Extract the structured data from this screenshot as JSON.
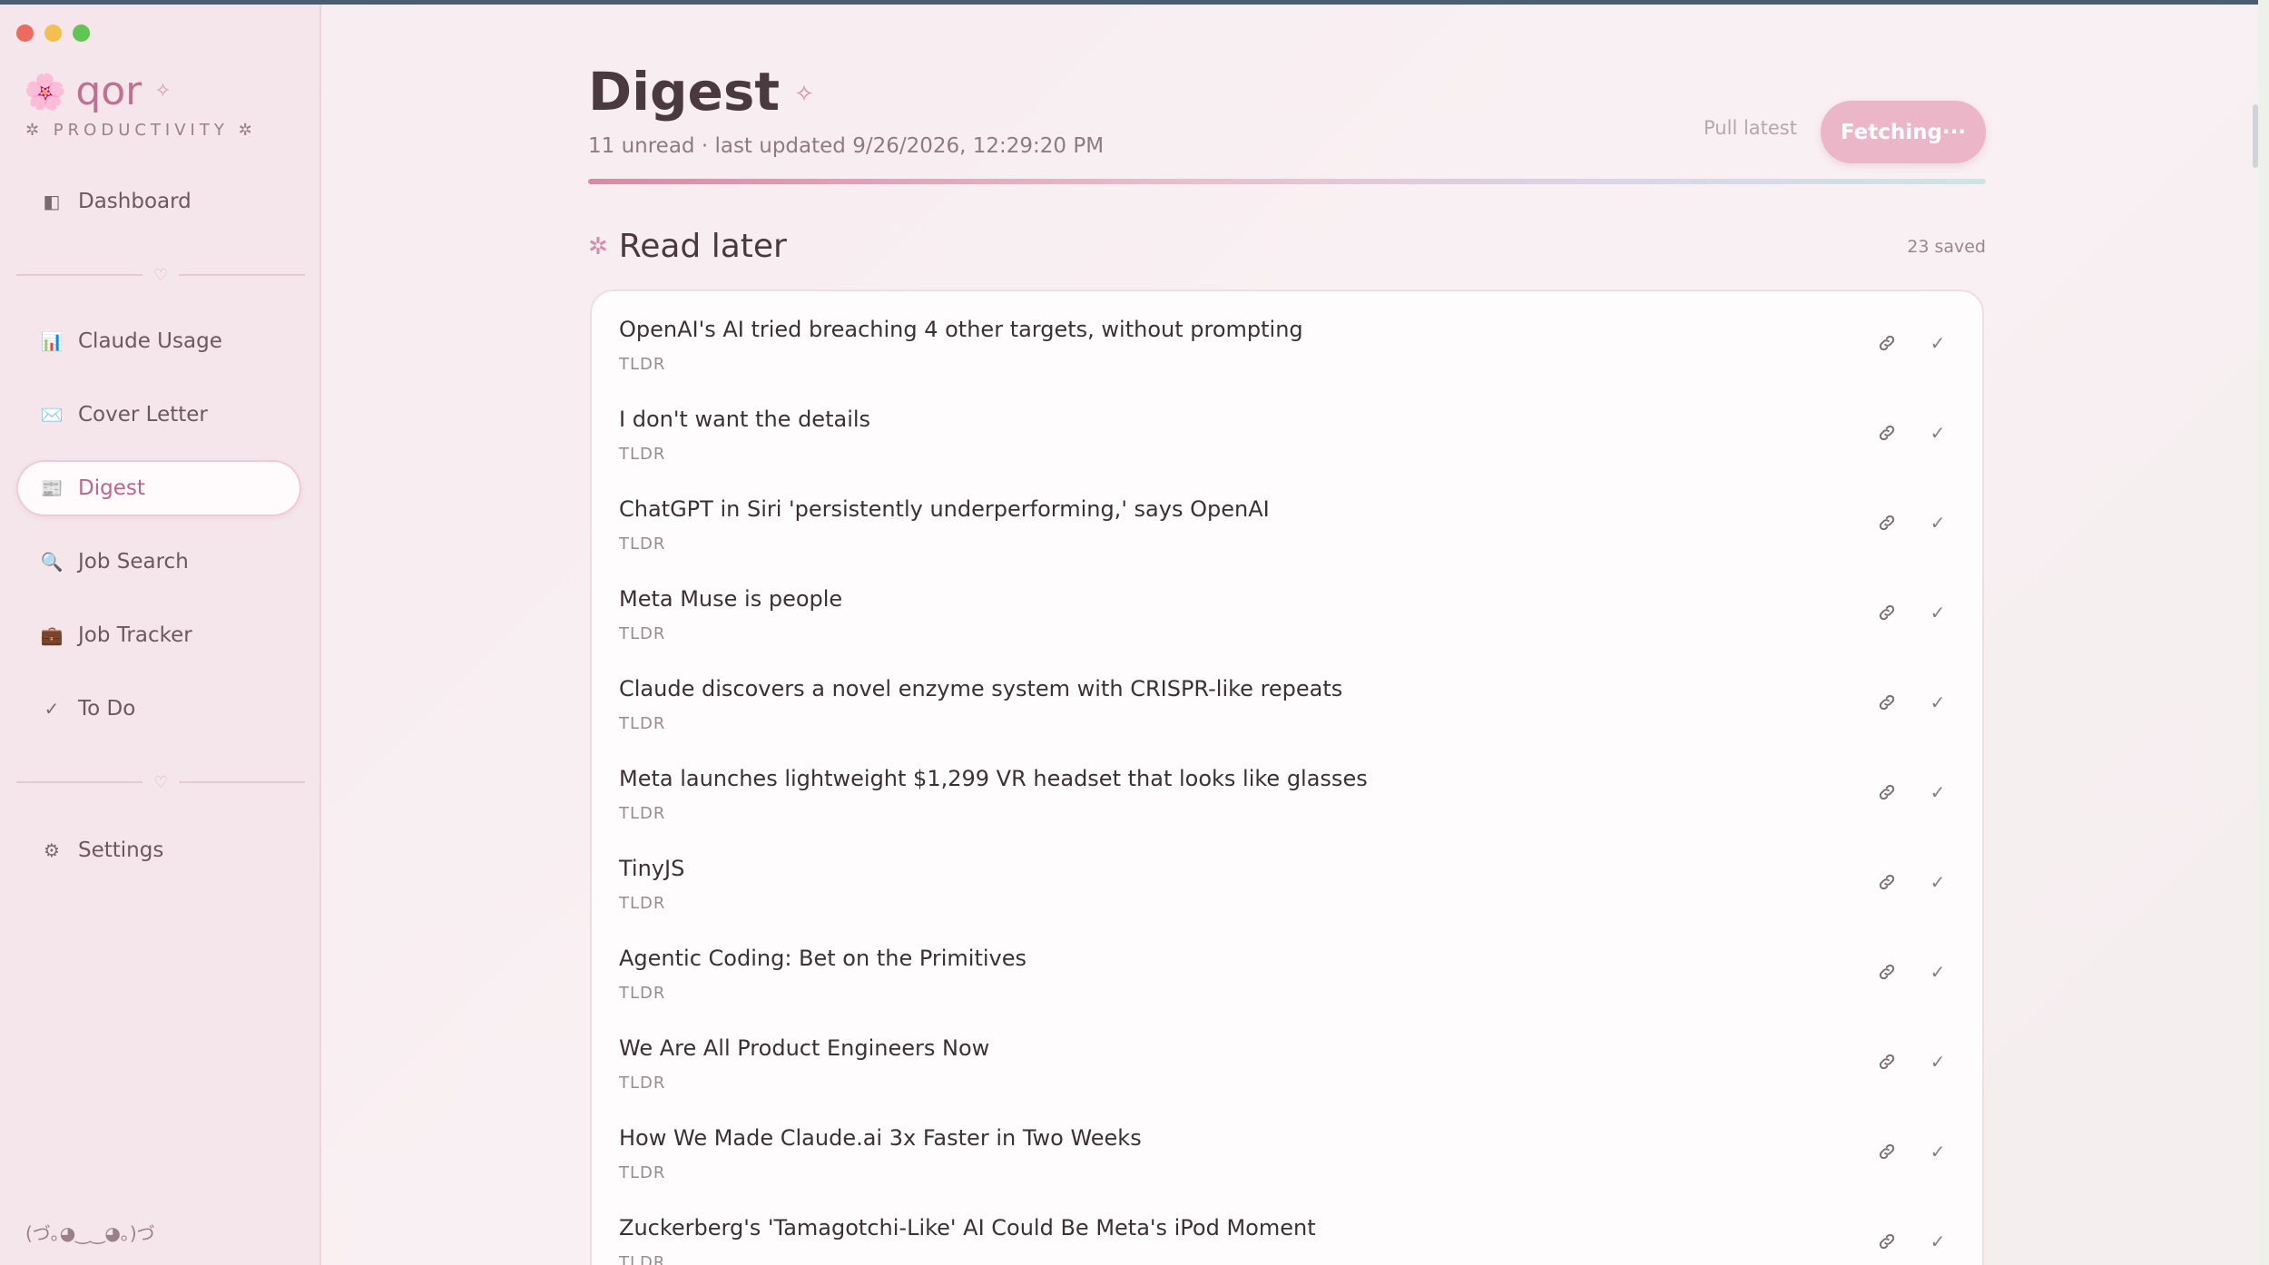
{
  "sidebar": {
    "brand": {
      "flower_icon": "cherry-blossom-icon",
      "name": "qor",
      "sparkle": "✧",
      "subtitle": "✲ PRODUCTIVITY ✲"
    },
    "items": [
      {
        "label": "Dashboard",
        "icon": "◧",
        "icon_name": "dashboard-icon"
      },
      {
        "label": "Claude Usage",
        "icon": "📊",
        "icon_name": "bar-chart-icon"
      },
      {
        "label": "Cover Letter",
        "icon": "✉️",
        "icon_name": "envelope-icon"
      },
      {
        "label": "Digest",
        "icon": "📰",
        "icon_name": "newspaper-icon",
        "active": true
      },
      {
        "label": "Job Search",
        "icon": "🔍",
        "icon_name": "magnifier-icon"
      },
      {
        "label": "Job Tracker",
        "icon": "💼",
        "icon_name": "briefcase-icon"
      },
      {
        "label": "To Do",
        "icon": "✓",
        "icon_name": "checkmark-icon"
      },
      {
        "label": "Settings",
        "icon": "⚙",
        "icon_name": "gear-icon"
      }
    ],
    "divider_heart": "♡",
    "kaomoji": "(づ｡◕‿‿◕｡)づ"
  },
  "header": {
    "title": "Digest",
    "title_sparkle": "✧",
    "subtitle": "11 unread · last updated 9/26/2026, 12:29:20 PM",
    "pull_latest_label": "Pull latest",
    "fetch_label": "Fetching···",
    "progress_fraction": 1.0
  },
  "section": {
    "icon": "✲",
    "title": "Read later",
    "saved_count": "23 saved"
  },
  "items": [
    {
      "title": "OpenAI's AI tried breaching 4 other targets, without prompting",
      "source": "TLDR"
    },
    {
      "title": "I don't want the details",
      "source": "TLDR"
    },
    {
      "title": "ChatGPT in Siri 'persistently underperforming,' says OpenAI",
      "source": "TLDR"
    },
    {
      "title": "Meta Muse is people",
      "source": "TLDR"
    },
    {
      "title": "Claude discovers a novel enzyme system with CRISPR-like repeats",
      "source": "TLDR"
    },
    {
      "title": "Meta launches lightweight $1,299 VR headset that looks like glasses",
      "source": "TLDR"
    },
    {
      "title": "TinyJS",
      "source": "TLDR"
    },
    {
      "title": "Agentic Coding: Bet on the Primitives",
      "source": "TLDR"
    },
    {
      "title": "We Are All Product Engineers Now",
      "source": "TLDR"
    },
    {
      "title": "How We Made Claude.ai 3x Faster in Two Weeks",
      "source": "TLDR"
    },
    {
      "title": "Zuckerberg's 'Tamagotchi-Like' AI Could Be Meta's iPod Moment",
      "source": "TLDR"
    }
  ],
  "row_actions": {
    "link_icon": "link-icon",
    "done_icon": "✓"
  },
  "colors": {
    "accent": "#c06488",
    "fetch_button": "#eab6c8",
    "sidebar_bg": "#f4e6eb"
  }
}
